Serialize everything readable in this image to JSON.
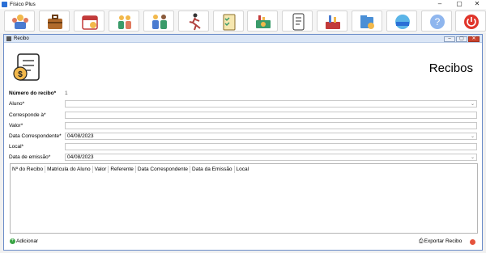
{
  "app": {
    "title": "Físico Plus"
  },
  "window_controls": {
    "minimize": "–",
    "maximize": "▢",
    "close": "✕"
  },
  "toolbar": {
    "buttons": [
      {
        "name": "users-icon"
      },
      {
        "name": "briefcase-icon"
      },
      {
        "name": "calendar-icon"
      },
      {
        "name": "family-icon"
      },
      {
        "name": "handshake-icon"
      },
      {
        "name": "runner-icon"
      },
      {
        "name": "checklist-icon"
      },
      {
        "name": "money-icon"
      },
      {
        "name": "receipt-icon"
      },
      {
        "name": "tools-icon"
      },
      {
        "name": "folder-icon"
      },
      {
        "name": "web-icon"
      },
      {
        "name": "help-icon"
      },
      {
        "name": "power-icon"
      }
    ]
  },
  "form_window": {
    "title": "Recibo",
    "heading": "Recibos",
    "fields": {
      "numero_label": "Número do recibo*",
      "numero_value": "1",
      "aluno_label": "Aluno*",
      "aluno_value": "",
      "corresponde_label": "Corresponde à*",
      "corresponde_value": "",
      "valor_label": "Valor*",
      "valor_value": "",
      "data_corr_label": "Data Correspondente*",
      "data_corr_value": "04/08/2023",
      "local_label": "Local*",
      "local_value": "",
      "data_emissao_label": "Data de emissão*",
      "data_emissao_value": "04/08/2023"
    },
    "grid": {
      "columns": [
        "Nº do Recibo",
        "Matricula do Aluno",
        "Valor",
        "Referente",
        "Data Correspondente",
        "Data da Emissão",
        "Local"
      ]
    },
    "buttons": {
      "add": "Adicionar",
      "export": "Exportar Recibo"
    }
  },
  "colors": {
    "accent": "#6a8cc8",
    "add_green": "#3aa545",
    "close_red": "#c9442f"
  }
}
